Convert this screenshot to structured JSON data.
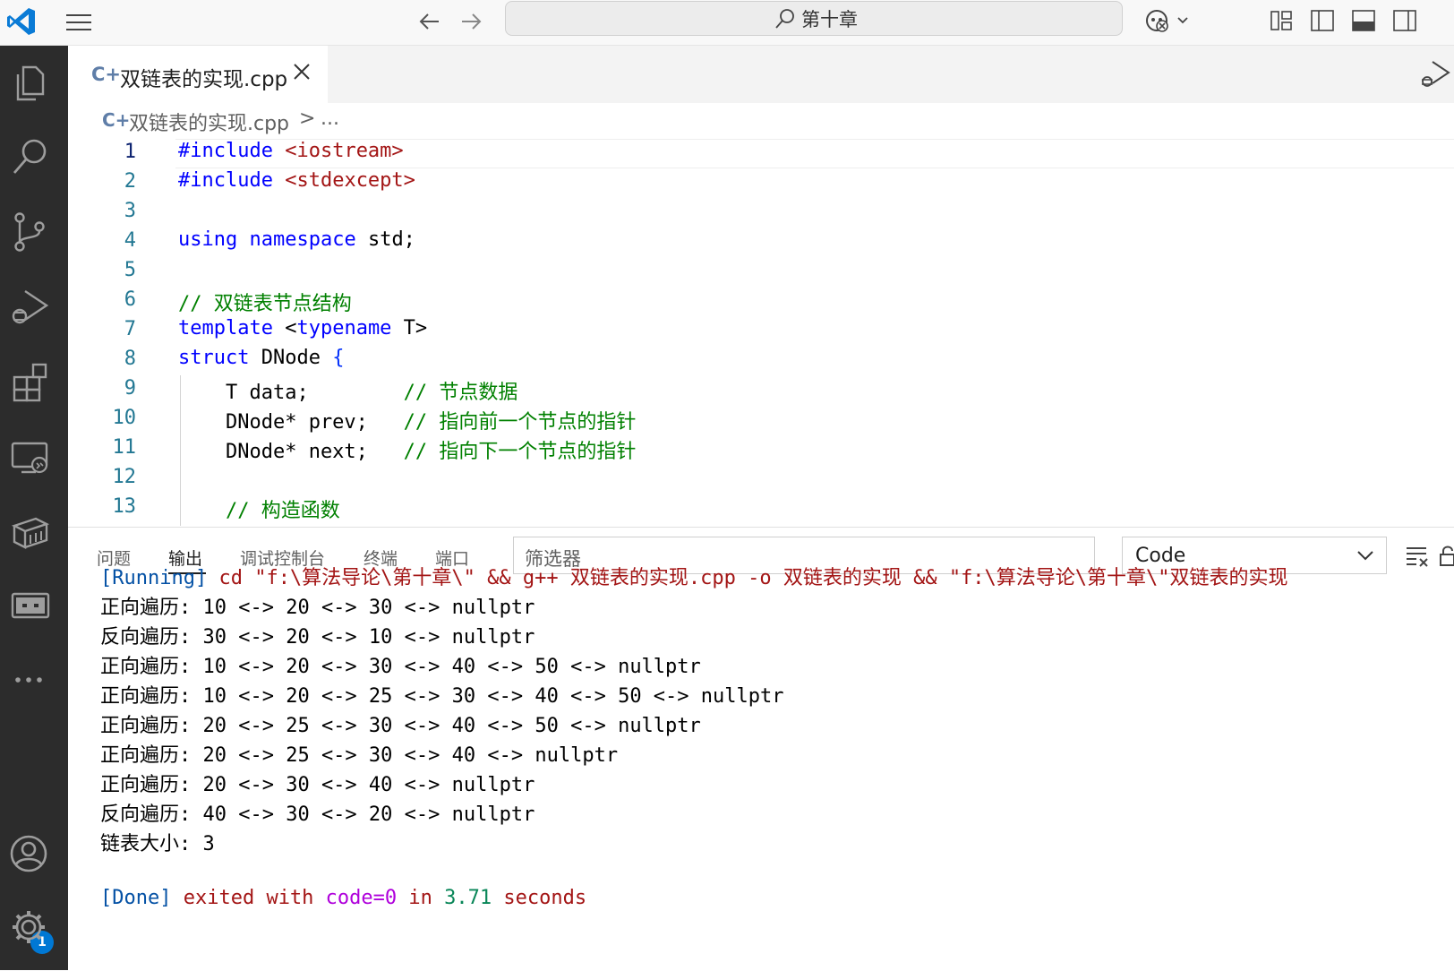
{
  "titlebar": {
    "search_text": "第十章"
  },
  "activity_bar": {
    "accounts_badge": "1"
  },
  "tab": {
    "icon_text": "C+",
    "label": "双链表的实现.cpp"
  },
  "breadcrumb": {
    "icon_text": "C+",
    "file": "双链表的实现.cpp",
    "separator": ">",
    "more": "..."
  },
  "editor": {
    "lines": [
      {
        "n": "1",
        "tokens": [
          [
            "kw",
            "#include "
          ],
          [
            "str",
            "<iostream>"
          ]
        ]
      },
      {
        "n": "2",
        "tokens": [
          [
            "kw",
            "#include "
          ],
          [
            "str",
            "<stdexcept>"
          ]
        ]
      },
      {
        "n": "3",
        "tokens": []
      },
      {
        "n": "4",
        "tokens": [
          [
            "kw",
            "using"
          ],
          [
            "",
            " "
          ],
          [
            "kw",
            "namespace"
          ],
          [
            "",
            " std;"
          ]
        ]
      },
      {
        "n": "5",
        "tokens": []
      },
      {
        "n": "6",
        "tokens": [
          [
            "cmt",
            "// 双链表节点结构"
          ]
        ]
      },
      {
        "n": "7",
        "tokens": [
          [
            "kw",
            "template"
          ],
          [
            "",
            " <"
          ],
          [
            "kw",
            "typename"
          ],
          [
            "",
            " T>"
          ]
        ]
      },
      {
        "n": "8",
        "tokens": [
          [
            "kw",
            "struct"
          ],
          [
            "",
            " DNode "
          ],
          [
            "brace",
            "{"
          ]
        ]
      },
      {
        "n": "9",
        "tokens": [
          [
            "",
            "    T data;        "
          ],
          [
            "cmt",
            "// 节点数据"
          ]
        ]
      },
      {
        "n": "10",
        "tokens": [
          [
            "",
            "    DNode* prev;   "
          ],
          [
            "cmt",
            "// 指向前一个节点的指针"
          ]
        ]
      },
      {
        "n": "11",
        "tokens": [
          [
            "",
            "    DNode* next;   "
          ],
          [
            "cmt",
            "// 指向下一个节点的指针"
          ]
        ]
      },
      {
        "n": "12",
        "tokens": []
      },
      {
        "n": "13",
        "tokens": [
          [
            "cmt",
            "    // 构造函数"
          ]
        ]
      }
    ]
  },
  "panel": {
    "tabs": [
      "问题",
      "输出",
      "调试控制台",
      "终端",
      "端口"
    ],
    "active_tab": "输出",
    "filter_placeholder": "筛选器",
    "channel": "Code",
    "output": [
      [
        [
          "o-blue",
          "[Running]"
        ],
        [
          "o-red",
          " cd \"f:\\算法导论\\第十章\\\" && g++ 双链表的实现.cpp -o 双链表的实现 && \"f:\\算法导论\\第十章\\\"双链表的实现"
        ]
      ],
      [
        [
          "",
          "正向遍历: 10 <-> 20 <-> 30 <-> nullptr"
        ]
      ],
      [
        [
          "",
          "反向遍历: 30 <-> 20 <-> 10 <-> nullptr"
        ]
      ],
      [
        [
          "",
          "正向遍历: 10 <-> 20 <-> 30 <-> 40 <-> 50 <-> nullptr"
        ]
      ],
      [
        [
          "",
          "正向遍历: 10 <-> 20 <-> 25 <-> 30 <-> 40 <-> 50 <-> nullptr"
        ]
      ],
      [
        [
          "",
          "正向遍历: 20 <-> 25 <-> 30 <-> 40 <-> 50 <-> nullptr"
        ]
      ],
      [
        [
          "",
          "正向遍历: 20 <-> 25 <-> 30 <-> 40 <-> nullptr"
        ]
      ],
      [
        [
          "",
          "正向遍历: 20 <-> 30 <-> 40 <-> nullptr"
        ]
      ],
      [
        [
          "",
          "反向遍历: 40 <-> 30 <-> 20 <-> nullptr"
        ]
      ],
      [
        [
          "",
          "链表大小: 3"
        ]
      ],
      [],
      [
        [
          "o-blue",
          "[Done]"
        ],
        [
          "o-red",
          " exited with "
        ],
        [
          "o-purple",
          "code=0"
        ],
        [
          "o-red",
          " in "
        ],
        [
          "o-green",
          "3.71"
        ],
        [
          "o-red",
          " seconds"
        ]
      ]
    ]
  },
  "colors": {
    "activity_bar": "#2c2c2c",
    "accent": "#0078d4",
    "keyword": "#0000ff",
    "string": "#a31515",
    "comment": "#008000"
  },
  "icons": [
    "vscode-logo-icon",
    "menu-icon",
    "arrow-left-icon",
    "arrow-right-icon",
    "search-icon",
    "copilot-icon",
    "customize-layout-icon",
    "toggle-sidebar-icon",
    "toggle-panel-icon",
    "toggle-secondary-sidebar-icon",
    "explorer-icon",
    "search-icon",
    "source-control-icon",
    "run-debug-icon",
    "extensions-icon",
    "remote-explorer-icon",
    "package-icon",
    "ports-icon",
    "more-icon",
    "accounts-icon",
    "settings-gear-icon",
    "close-icon",
    "run-file-icon",
    "clear-output-icon",
    "lock-icon"
  ]
}
